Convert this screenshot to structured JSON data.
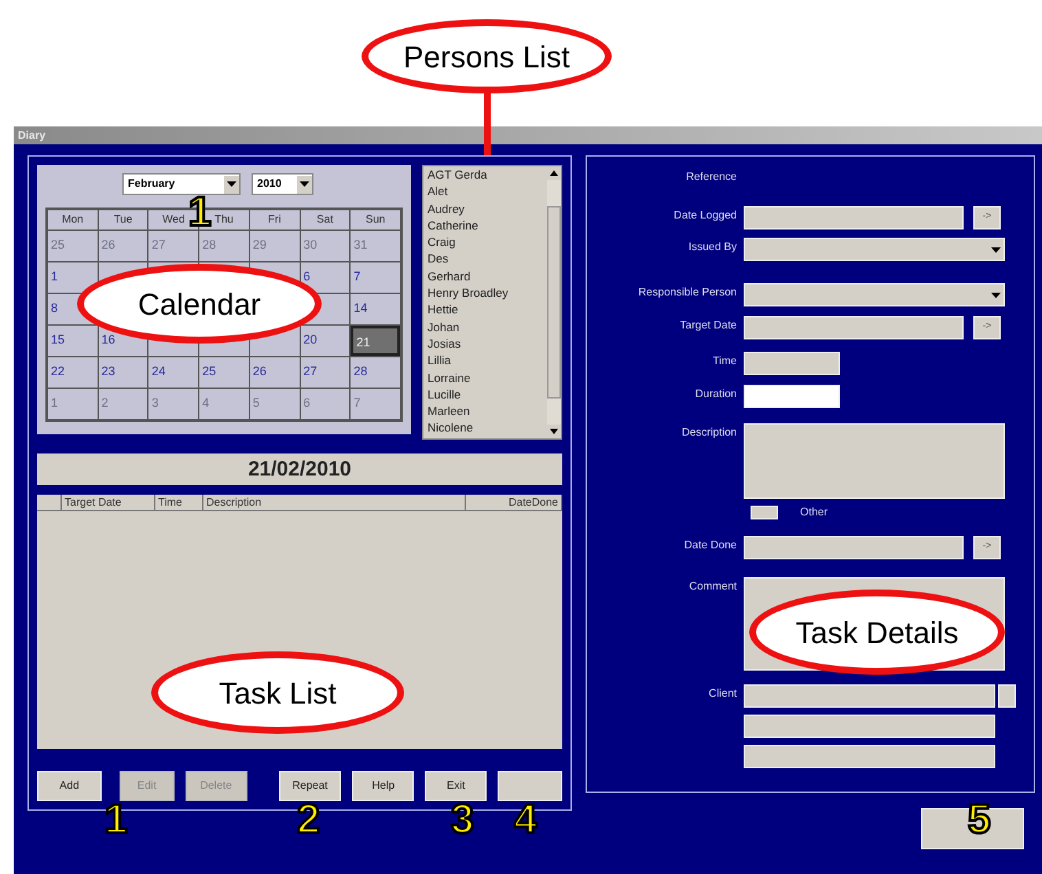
{
  "window": {
    "title": "Diary"
  },
  "calendar": {
    "month": "February",
    "year": "2010",
    "weekdays": [
      "Mon",
      "Tue",
      "Wed",
      "Thu",
      "Fri",
      "Sat",
      "Sun"
    ],
    "days": [
      {
        "label": "25",
        "in_month": false,
        "selected": false
      },
      {
        "label": "26",
        "in_month": false,
        "selected": false
      },
      {
        "label": "27",
        "in_month": false,
        "selected": false
      },
      {
        "label": "28",
        "in_month": false,
        "selected": false
      },
      {
        "label": "29",
        "in_month": false,
        "selected": false
      },
      {
        "label": "30",
        "in_month": false,
        "selected": false
      },
      {
        "label": "31",
        "in_month": false,
        "selected": false
      },
      {
        "label": "1",
        "in_month": true,
        "selected": false
      },
      {
        "kind": "blank"
      },
      {
        "kind": "blank"
      },
      {
        "kind": "blank"
      },
      {
        "kind": "blank"
      },
      {
        "label": "6",
        "in_month": true,
        "selected": false
      },
      {
        "label": "7",
        "in_month": true,
        "selected": false
      },
      {
        "label": "8",
        "in_month": true,
        "selected": false
      },
      {
        "kind": "blank"
      },
      {
        "kind": "blank"
      },
      {
        "kind": "blank"
      },
      {
        "kind": "blank"
      },
      {
        "kind": "blank"
      },
      {
        "label": "14",
        "in_month": true,
        "selected": false
      },
      {
        "label": "15",
        "in_month": true,
        "selected": false
      },
      {
        "label": "16",
        "in_month": true,
        "selected": false
      },
      {
        "kind": "blank"
      },
      {
        "kind": "blank"
      },
      {
        "kind": "blank"
      },
      {
        "label": "20",
        "in_month": true,
        "selected": false
      },
      {
        "label": "21",
        "in_month": true,
        "selected": true
      },
      {
        "label": "22",
        "in_month": true,
        "selected": false
      },
      {
        "label": "23",
        "in_month": true,
        "selected": false
      },
      {
        "label": "24",
        "in_month": true,
        "selected": false
      },
      {
        "label": "25",
        "in_month": true,
        "selected": false
      },
      {
        "label": "26",
        "in_month": true,
        "selected": false
      },
      {
        "label": "27",
        "in_month": true,
        "selected": false
      },
      {
        "label": "28",
        "in_month": true,
        "selected": false
      },
      {
        "label": "1",
        "in_month": false,
        "selected": false
      },
      {
        "label": "2",
        "in_month": false,
        "selected": false
      },
      {
        "label": "3",
        "in_month": false,
        "selected": false
      },
      {
        "label": "4",
        "in_month": false,
        "selected": false
      },
      {
        "label": "5",
        "in_month": false,
        "selected": false
      },
      {
        "label": "6",
        "in_month": false,
        "selected": false
      },
      {
        "label": "7",
        "in_month": false,
        "selected": false
      }
    ]
  },
  "persons": [
    "AGT Gerda",
    "Alet",
    "Audrey",
    "Catherine",
    "Craig",
    "Des",
    "Gerhard",
    "Henry Broadley",
    "Hettie",
    "Johan",
    "Josias",
    "Lillia",
    "Lorraine",
    "Lucille",
    "Marleen",
    "Nicolene"
  ],
  "selected_date": "21/02/2010",
  "task_list": {
    "columns": [
      "Target Date",
      "Time",
      "Description",
      "DateDone"
    ]
  },
  "buttons": [
    {
      "label": "Add",
      "disabled": false
    },
    {
      "label": "Edit",
      "disabled": true
    },
    {
      "label": "Delete",
      "disabled": true
    },
    {
      "label": "Repeat",
      "disabled": false
    },
    {
      "label": "Help",
      "disabled": false
    },
    {
      "label": "Exit",
      "disabled": false
    },
    {
      "disabled": false
    }
  ],
  "details": [
    {
      "kind": "label",
      "label": "Reference"
    },
    {
      "kind": "date",
      "label": "Date Logged",
      "button": "->"
    },
    {
      "kind": "combo",
      "label": "Issued By"
    },
    {
      "kind": "combo",
      "label": "Responsible Person"
    },
    {
      "kind": "date",
      "label": "Target Date",
      "button": "->"
    },
    {
      "kind": "short",
      "label": "Time"
    },
    {
      "kind": "short_white",
      "label": "Duration"
    },
    {
      "kind": "area",
      "label": "Description"
    },
    {
      "kind": "check",
      "label": "Other"
    },
    {
      "kind": "date",
      "label": "Date Done",
      "button": "->"
    },
    {
      "kind": "area",
      "label": "Comment"
    },
    {
      "kind": "client",
      "label": "Client"
    }
  ],
  "callouts": [
    {
      "kind": "ellipse",
      "text": "Persons List"
    },
    {
      "kind": "ellipse",
      "text": "Calendar"
    },
    {
      "kind": "ellipse",
      "text": "Task List"
    },
    {
      "kind": "ellipse",
      "text": "Task Details"
    },
    {
      "kind": "number",
      "text": "1"
    },
    {
      "kind": "number",
      "text": "1"
    },
    {
      "kind": "number",
      "text": "2"
    },
    {
      "kind": "number",
      "text": "3"
    },
    {
      "kind": "number",
      "text": "4"
    },
    {
      "kind": "number",
      "text": "5"
    }
  ]
}
